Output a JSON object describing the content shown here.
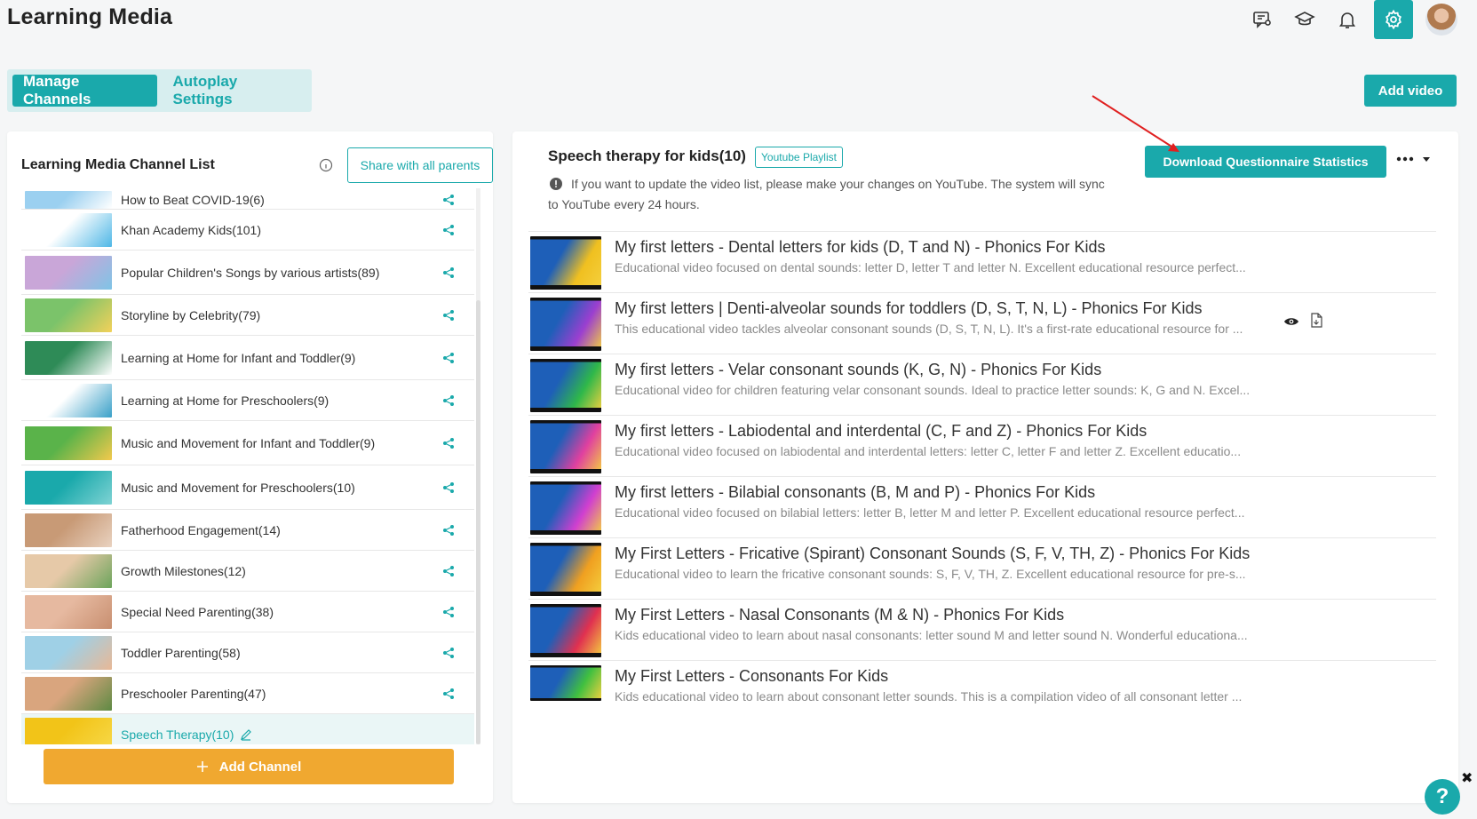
{
  "header": {
    "title": "Learning Media",
    "icons": [
      "chat-icon",
      "graduation-cap-icon",
      "bell-icon",
      "gear-icon",
      "avatar"
    ]
  },
  "tabs": [
    {
      "label": "Manage Channels",
      "active": true
    },
    {
      "label": "Autoplay Settings",
      "active": false
    }
  ],
  "add_video_label": "Add video",
  "channels_panel": {
    "title": "Learning Media Channel List",
    "share_all_label": "Share with all parents",
    "add_channel_label": "Add Channel",
    "items": [
      {
        "name": "How to Beat COVID-19(6)",
        "thumb": [
          "#9bd0f0",
          "#ffffff"
        ]
      },
      {
        "name": "Khan Academy Kids(101)",
        "thumb": [
          "#ffffff",
          "#4fb7e6"
        ]
      },
      {
        "name": "Popular Children's Songs by various artists(89)",
        "thumb": [
          "#c9a6d8",
          "#7fc4e6"
        ]
      },
      {
        "name": "Storyline by Celebrity(79)",
        "thumb": [
          "#7bc36a",
          "#f3d15a"
        ]
      },
      {
        "name": "Learning at Home for Infant and Toddler(9)",
        "thumb": [
          "#2e8b57",
          "#ffffff"
        ]
      },
      {
        "name": "Learning at Home for Preschoolers(9)",
        "thumb": [
          "#ffffff",
          "#3aa0c8"
        ]
      },
      {
        "name": "Music and Movement for Infant and Toddler(9)",
        "thumb": [
          "#5ab34a",
          "#f2c94c"
        ]
      },
      {
        "name": "Music and Movement for Preschoolers(10)",
        "thumb": [
          "#1aa9ab",
          "#7fd3d4"
        ]
      },
      {
        "name": "Fatherhood Engagement(14)",
        "thumb": [
          "#c89a76",
          "#e9d2c0"
        ]
      },
      {
        "name": "Growth Milestones(12)",
        "thumb": [
          "#e6c9a8",
          "#6ca45b"
        ]
      },
      {
        "name": "Special Need Parenting(38)",
        "thumb": [
          "#e6b9a0",
          "#c88f70"
        ]
      },
      {
        "name": "Toddler Parenting(58)",
        "thumb": [
          "#9fd0e6",
          "#e8b896"
        ]
      },
      {
        "name": "Preschooler Parenting(47)",
        "thumb": [
          "#d9a57e",
          "#5e8a43"
        ]
      },
      {
        "name": "Speech Therapy(10)",
        "thumb": [
          "#f2c418",
          "#f7d94a"
        ],
        "selected": true
      }
    ]
  },
  "playlist": {
    "title": "Speech therapy for kids(10)",
    "badge": "Youtube Playlist",
    "note": "If you want to update the video list, please make your changes on YouTube. The system will sync to YouTube every 24 hours.",
    "download_label": "Download Questionnaire Statistics",
    "videos": [
      {
        "title": "My first letters - Dental letters for kids (D, T and N) - Phonics For Kids",
        "desc": "Educational video focused on dental sounds: letter D, letter T and letter N. Excellent educational resource perfect...",
        "thumb": [
          "#1e5fb8",
          "#f0c020"
        ]
      },
      {
        "title": "My first letters | Denti-alveolar sounds for toddlers (D, S, T, N, L) - Phonics For Kids",
        "desc": "This educational video tackles alveolar consonant sounds (D, S, T, N, L). It's a first-rate educational resource for ...",
        "thumb": [
          "#1e5fb8",
          "#9b3fd0"
        ]
      },
      {
        "title": "My first letters - Velar consonant sounds (K, G, N) - Phonics For Kids",
        "desc": "Educational video for children featuring velar consonant sounds. Ideal to practice letter sounds: K, G and N. Excel...",
        "thumb": [
          "#1e5fb8",
          "#2fb84a"
        ]
      },
      {
        "title": "My first letters - Labiodental and interdental (C, F and Z) - Phonics For Kids",
        "desc": "Educational video focused on labiodental and interdental letters: letter C, letter F and letter Z. Excellent educatio...",
        "thumb": [
          "#1e5fb8",
          "#e040a0"
        ]
      },
      {
        "title": "My first letters - Bilabial consonants (B, M and P) - Phonics For Kids",
        "desc": "Educational video focused on bilabial letters: letter B, letter M and letter P. Excellent educational resource perfect...",
        "thumb": [
          "#1e5fb8",
          "#d03fd0"
        ]
      },
      {
        "title": "My First Letters - Fricative (Spirant) Consonant Sounds (S, F, V, TH, Z) - Phonics For Kids",
        "desc": "Educational video to learn the fricative consonant sounds: S, F, V, TH, Z. Excellent educational resource for pre-s...",
        "thumb": [
          "#1e5fb8",
          "#f0a020"
        ]
      },
      {
        "title": "My First Letters - Nasal Consonants (M & N) - Phonics For Kids",
        "desc": "Kids educational video to learn about nasal consonants: letter sound M and letter sound N. Wonderful educationa...",
        "thumb": [
          "#1e5fb8",
          "#e03050"
        ]
      },
      {
        "title": "My First Letters - Consonants For Kids",
        "desc": "Kids educational video to learn about consonant letter sounds. This is a compilation video of all consonant letter ...",
        "thumb": [
          "#1e5fb8",
          "#40c040"
        ]
      }
    ]
  },
  "colors": {
    "accent": "#1aa9ab",
    "orange": "#f0a830",
    "annotation_arrow": "#e02020"
  },
  "help_label": "?"
}
